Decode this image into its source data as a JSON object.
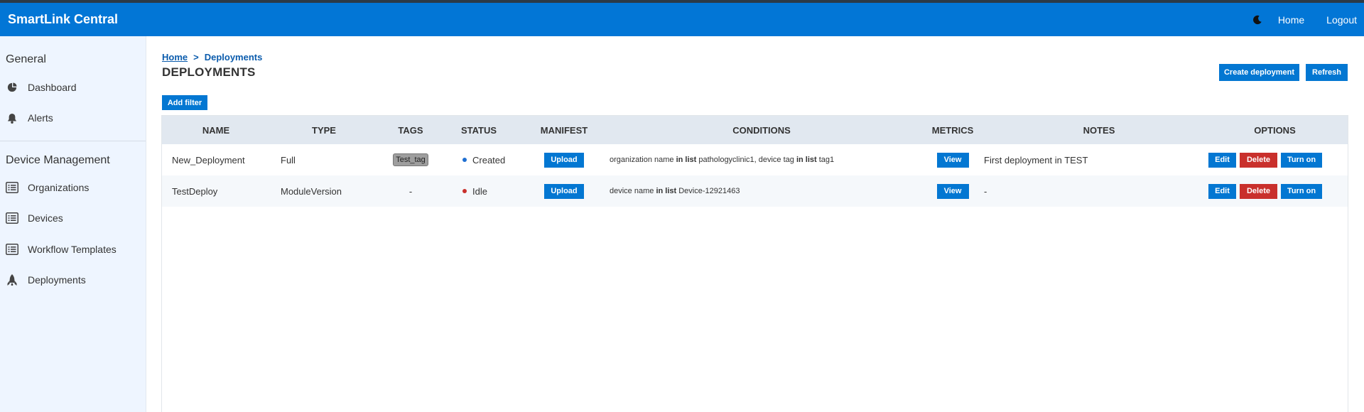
{
  "app": {
    "title": "SmartLink Central"
  },
  "navbar": {
    "home_label": "Home",
    "logout_label": "Logout",
    "theme_icon": "moon-icon"
  },
  "sidebar": {
    "sections": [
      {
        "title": "General",
        "items": [
          {
            "label": "Dashboard",
            "icon": "pie-chart-icon"
          },
          {
            "label": "Alerts",
            "icon": "bell-icon"
          }
        ]
      },
      {
        "title": "Device Management",
        "items": [
          {
            "label": "Organizations",
            "icon": "list-icon"
          },
          {
            "label": "Devices",
            "icon": "list-icon"
          },
          {
            "label": "Workflow Templates",
            "icon": "list-icon"
          },
          {
            "label": "Deployments",
            "icon": "rocket-icon"
          }
        ]
      }
    ]
  },
  "breadcrumb": {
    "home": "Home",
    "separator": ">",
    "current": "Deployments"
  },
  "page": {
    "title": "DEPLOYMENTS",
    "create_label": "Create deployment",
    "refresh_label": "Refresh",
    "filter_label": "Add filter"
  },
  "table": {
    "columns": [
      "NAME",
      "TYPE",
      "TAGS",
      "STATUS",
      "MANIFEST",
      "CONDITIONS",
      "METRICS",
      "NOTES",
      "OPTIONS"
    ],
    "rows": [
      {
        "name": "New_Deployment",
        "type": "Full",
        "tag": "Test_tag",
        "status": "Created",
        "status_color": "#1f6fd1",
        "manifest_label": "Upload",
        "conditions": [
          {
            "text": "organization name "
          },
          {
            "text": "in list",
            "bold": true
          },
          {
            "text": " pathologyclinic1, device tag "
          },
          {
            "text": "in list",
            "bold": true
          },
          {
            "text": " tag1"
          }
        ],
        "metrics_label": "View",
        "notes": "First deployment in TEST",
        "edit_label": "Edit",
        "delete_label": "Delete",
        "turn_on_label": "Turn on"
      },
      {
        "name": "TestDeploy",
        "type": "ModuleVersion",
        "tag": "-",
        "status": "Idle",
        "status_color": "#c9302c",
        "manifest_label": "Upload",
        "conditions": [
          {
            "text": "device name "
          },
          {
            "text": "in list",
            "bold": true
          },
          {
            "text": " Device-12921463"
          }
        ],
        "metrics_label": "View",
        "notes": "-",
        "edit_label": "Edit",
        "delete_label": "Delete",
        "turn_on_label": "Turn on"
      }
    ]
  },
  "colors": {
    "navbar": "#0276d6",
    "primary_button": "#0377d2",
    "danger_button": "#c9302c",
    "sidebar_bg": "#eef5ff",
    "table_header_bg": "#e1e8f0"
  }
}
